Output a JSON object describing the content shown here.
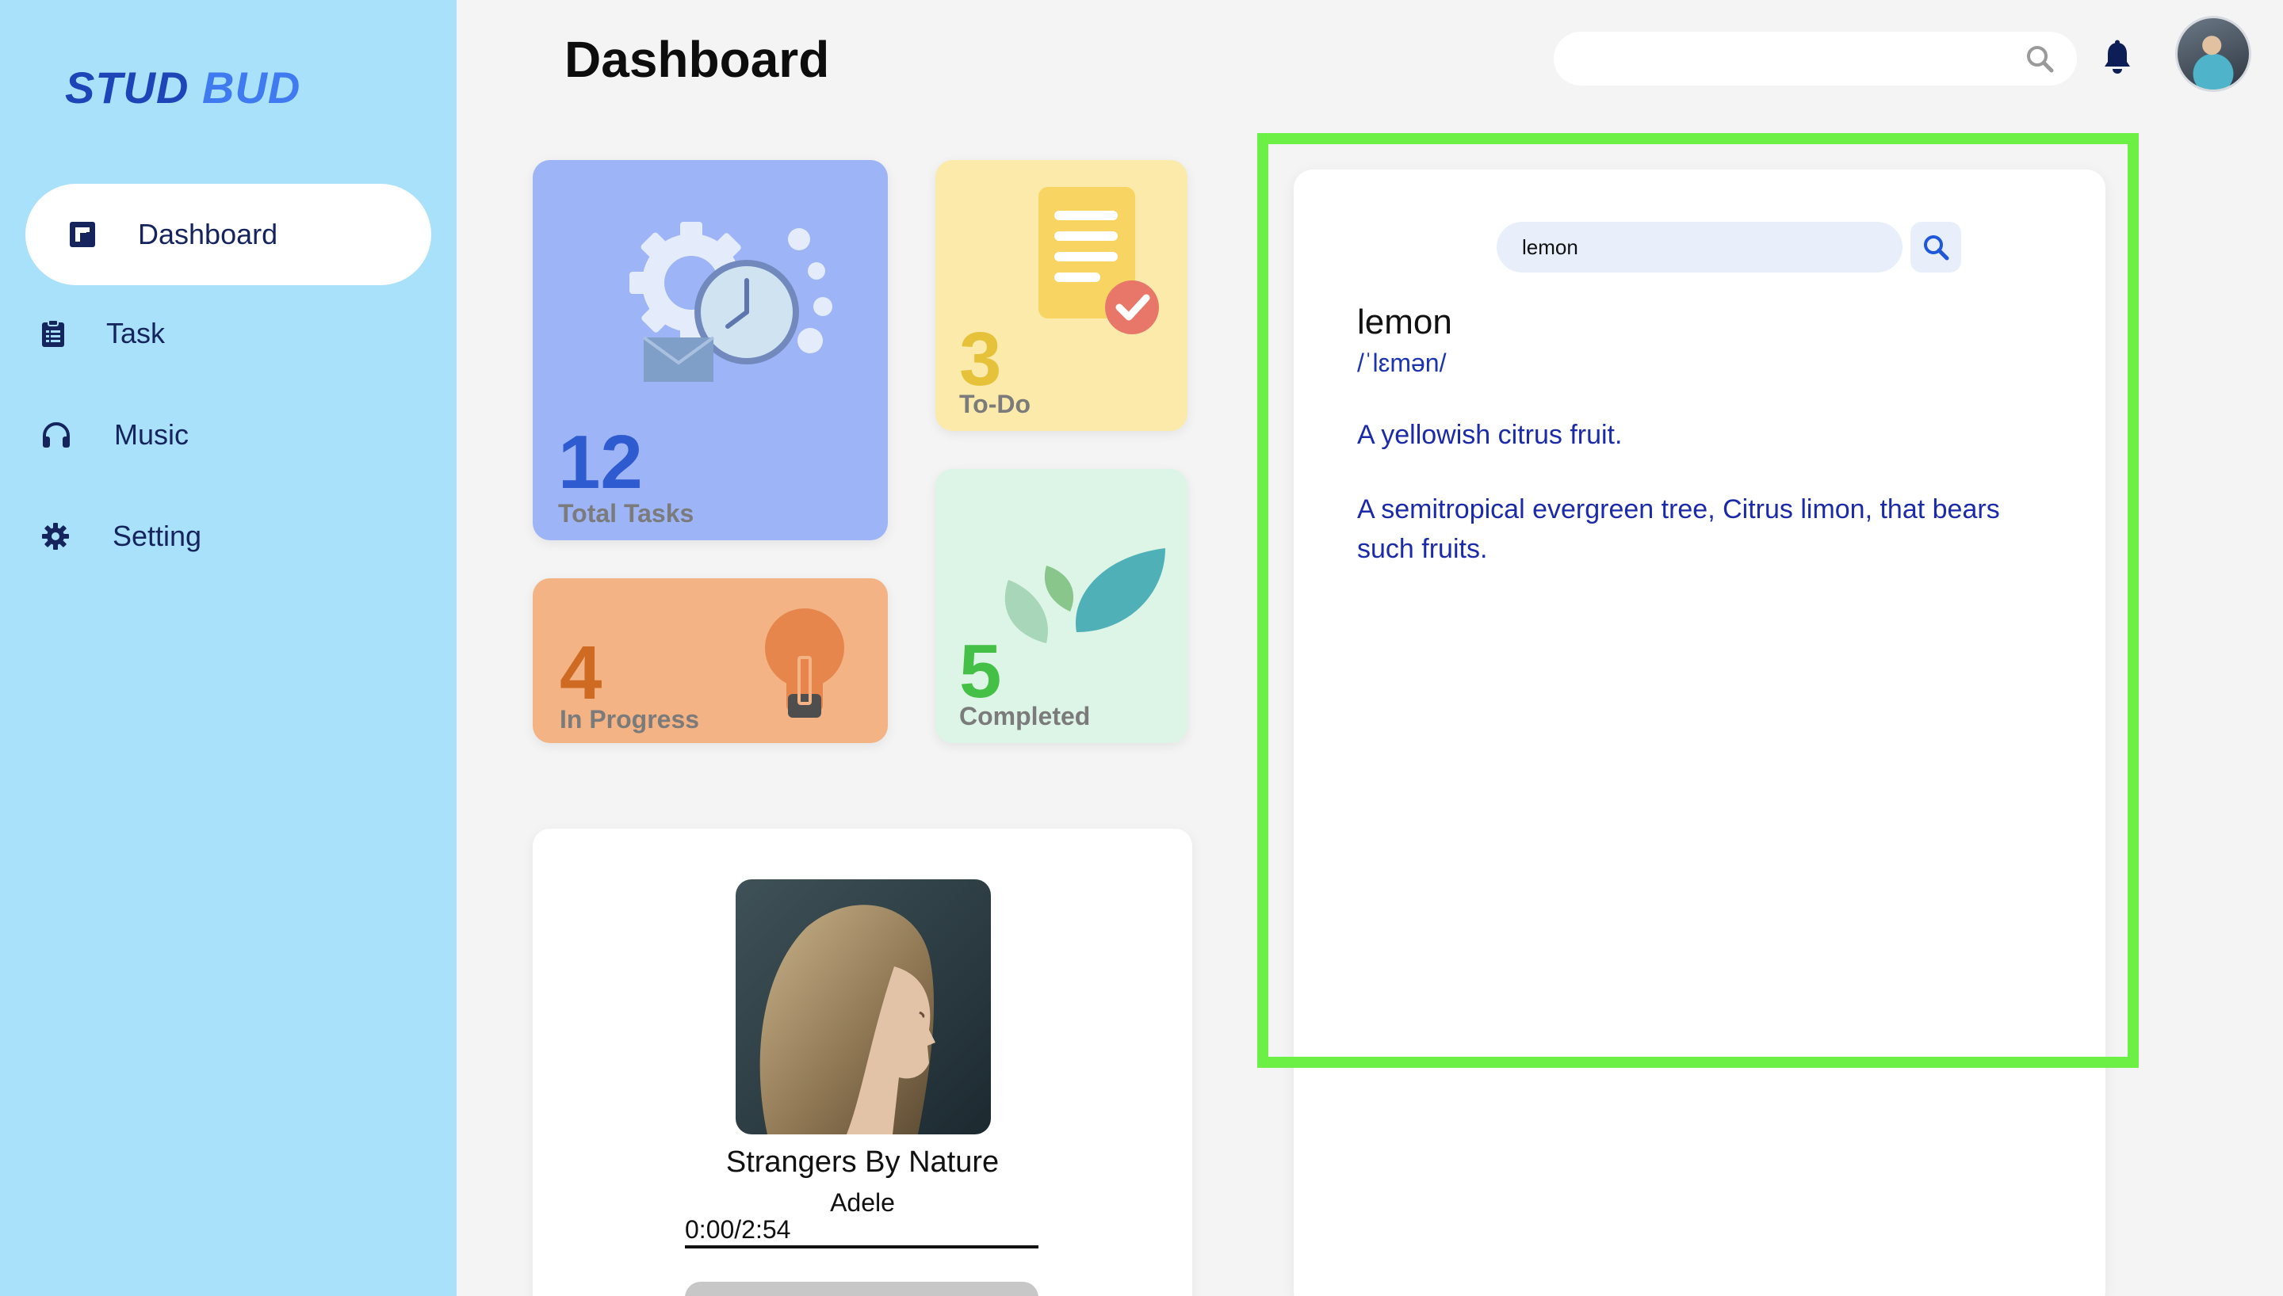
{
  "sidebar": {
    "logo_part1": "STUD",
    "logo_part2": "BUD",
    "items": [
      {
        "label": "Dashboard",
        "icon": "dashboard-icon",
        "active": true
      },
      {
        "label": "Task",
        "icon": "clipboard-icon",
        "active": false
      },
      {
        "label": "Music",
        "icon": "headphones-icon",
        "active": false
      },
      {
        "label": "Setting",
        "icon": "gear-icon",
        "active": false
      }
    ]
  },
  "header": {
    "title": "Dashboard",
    "search_value": "",
    "icons": [
      "search-icon",
      "bell-icon",
      "avatar"
    ]
  },
  "stats": {
    "total": {
      "value": "12",
      "label": "Total Tasks"
    },
    "todo": {
      "value": "3",
      "label": "To-Do"
    },
    "in_progress": {
      "value": "4",
      "label": "In Progress"
    },
    "completed": {
      "value": "5",
      "label": "Completed"
    }
  },
  "music": {
    "title": "Strangers By Nature",
    "artist": "Adele",
    "time": "0:00/2:54",
    "progress_fraction": 0
  },
  "dictionary": {
    "search_value": "lemon",
    "word": "lemon",
    "phonetic": "/ˈlɛmən/",
    "definitions": [
      "A yellowish citrus fruit.",
      "A semitropical evergreen tree, Citrus limon, that bears such fruits."
    ]
  },
  "colors": {
    "sidebar_bg": "#a9e1fb",
    "highlight": "#6cf046",
    "total_card": "#9db4f7",
    "todo_card": "#fbeaa9",
    "progress_card": "#f3b384",
    "completed_card": "#ddf5e6"
  }
}
